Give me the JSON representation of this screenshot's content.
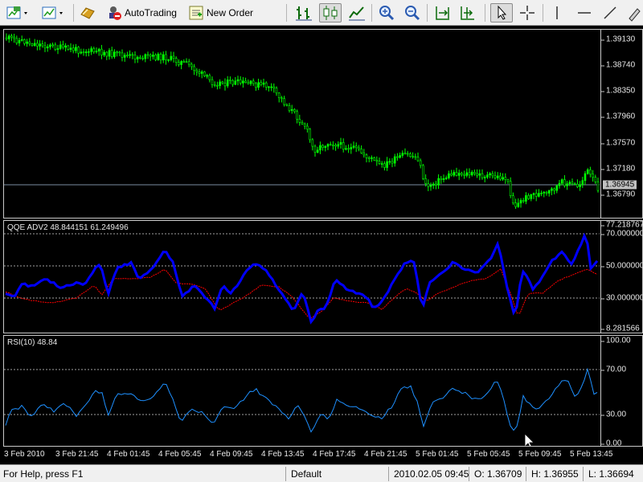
{
  "toolbar": {
    "autotrading_label": "AutoTrading",
    "new_order_label": "New Order"
  },
  "main_chart": {
    "price_labels": [
      "1.39130",
      "1.38740",
      "1.38350",
      "1.37960",
      "1.37570",
      "1.37180",
      "1.36790"
    ],
    "current_price": "1.36945",
    "current_price_color": "#c0c0c0"
  },
  "qqe_pane": {
    "title": "QQE ADV2 48.844151 61.249496",
    "labels": [
      "77.218767",
      "70.000000",
      "50.000000",
      "30.000000",
      "8.281566"
    ]
  },
  "rsi_pane": {
    "title": "RSI(10) 48.84",
    "labels": [
      "100.00",
      "70.00",
      "30.00",
      "0.00"
    ]
  },
  "time_axis": {
    "labels": [
      "3 Feb 2010",
      "3 Feb 21:45",
      "4 Feb 01:45",
      "4 Feb 05:45",
      "4 Feb 09:45",
      "4 Feb 13:45",
      "4 Feb 17:45",
      "4 Feb 21:45",
      "5 Feb 01:45",
      "5 Feb 05:45",
      "5 Feb 09:45",
      "5 Feb 13:45"
    ]
  },
  "statusbar": {
    "help_text": "For Help, press F1",
    "profile": "Default",
    "datetime": "2010.02.05 09:45",
    "open": "O: 1.36709",
    "high": "H: 1.36955",
    "low": "L: 1.36694"
  },
  "colors": {
    "candles": "#00ff00",
    "qqe_main": "#0000ff",
    "qqe_signal": "#ff0000",
    "rsi_line": "#1e90ff",
    "background": "#000000"
  }
}
